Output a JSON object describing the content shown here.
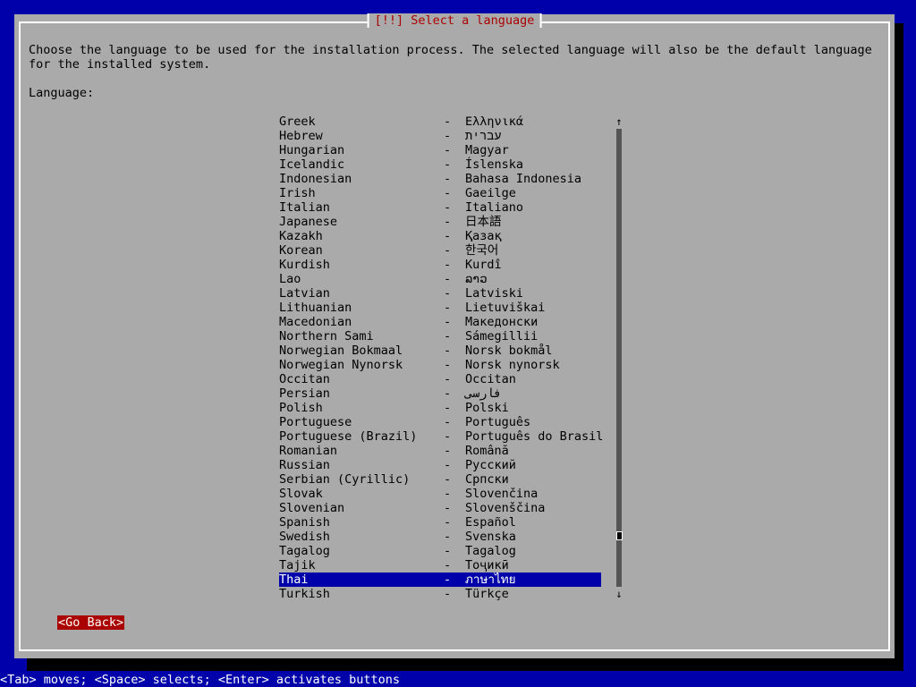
{
  "dialog": {
    "title": "[!!] Select a language",
    "description": "Choose the language to be used for the installation process. The selected language will also be the default language for the installed system.",
    "field_label": "Language:"
  },
  "languages": [
    {
      "name": "Greek",
      "native": "Ελληνικά"
    },
    {
      "name": "Hebrew",
      "native": "עברית"
    },
    {
      "name": "Hungarian",
      "native": "Magyar"
    },
    {
      "name": "Icelandic",
      "native": "Íslenska"
    },
    {
      "name": "Indonesian",
      "native": "Bahasa Indonesia"
    },
    {
      "name": "Irish",
      "native": "Gaeilge"
    },
    {
      "name": "Italian",
      "native": "Italiano"
    },
    {
      "name": "Japanese",
      "native": "日本語"
    },
    {
      "name": "Kazakh",
      "native": "Қазақ"
    },
    {
      "name": "Korean",
      "native": "한국어"
    },
    {
      "name": "Kurdish",
      "native": "Kurdî"
    },
    {
      "name": "Lao",
      "native": "ລາວ"
    },
    {
      "name": "Latvian",
      "native": "Latviski"
    },
    {
      "name": "Lithuanian",
      "native": "Lietuviškai"
    },
    {
      "name": "Macedonian",
      "native": "Македонски"
    },
    {
      "name": "Northern Sami",
      "native": "Sámegillii"
    },
    {
      "name": "Norwegian Bokmaal",
      "native": "Norsk bokmål"
    },
    {
      "name": "Norwegian Nynorsk",
      "native": "Norsk nynorsk"
    },
    {
      "name": "Occitan",
      "native": "Occitan"
    },
    {
      "name": "Persian",
      "native": "فارسی"
    },
    {
      "name": "Polish",
      "native": "Polski"
    },
    {
      "name": "Portuguese",
      "native": "Português"
    },
    {
      "name": "Portuguese (Brazil)",
      "native": "Português do Brasil"
    },
    {
      "name": "Romanian",
      "native": "Română"
    },
    {
      "name": "Russian",
      "native": "Русский"
    },
    {
      "name": "Serbian (Cyrillic)",
      "native": "Српски"
    },
    {
      "name": "Slovak",
      "native": "Slovenčina"
    },
    {
      "name": "Slovenian",
      "native": "Slovenščina"
    },
    {
      "name": "Spanish",
      "native": "Español"
    },
    {
      "name": "Swedish",
      "native": "Svenska"
    },
    {
      "name": "Tagalog",
      "native": "Tagalog"
    },
    {
      "name": "Tajik",
      "native": "Тоҷикӣ"
    },
    {
      "name": "Thai",
      "native": "ภาษาไทย",
      "selected": true
    },
    {
      "name": "Turkish",
      "native": "Türkçe"
    }
  ],
  "separator": "-",
  "scrollbar": {
    "up_arrow": "↑",
    "down_arrow": "↓"
  },
  "buttons": {
    "go_back": "<Go Back>"
  },
  "footer": "<Tab> moves; <Space> selects; <Enter> activates buttons",
  "colors": {
    "background": "#0000aa",
    "dialog": "#aaaaaa",
    "title": "#aa0000",
    "selection": "#0000aa",
    "button": "#aa0000"
  }
}
